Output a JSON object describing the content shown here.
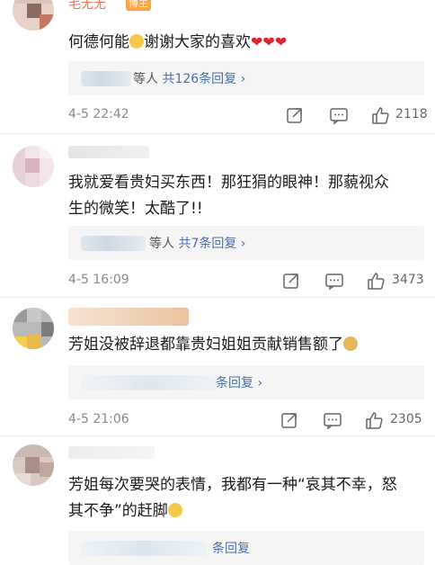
{
  "comments": [
    {
      "username": "毛无无",
      "badge": "博主",
      "text": "何德何能",
      "text_after_emoji": "谢谢大家的喜欢",
      "hearts": "❤❤❤",
      "reply_who": "等人",
      "reply_count": "共126条回复 ›",
      "date": "4-5 22:42",
      "likes": "2118"
    },
    {
      "text_line1": "我就爱看贵妇买东西！那狂狷的眼神！那藐视众",
      "text_line2": "生的微笑！太酷了!!",
      "reply_who": "等人",
      "reply_count": "共7条回复 ›",
      "date": "4-5 16:09",
      "likes": "3473"
    },
    {
      "text": "芳姐没被辞退都靠贵妇姐姐贡献销售额了",
      "reply_tail": "条回复 ›",
      "date": "4-5 21:06",
      "likes": "2305"
    },
    {
      "text_line1": "芳姐每次要哭的表情，我都有一种“哀其不幸，怒",
      "text_line2": "其不争”的赶脚",
      "reply_tail": "条回复"
    }
  ],
  "icons": {
    "repost": "repost-icon",
    "comment": "comment-icon",
    "like": "thumbs-up-icon"
  },
  "colors": {
    "link": "#4a6fa5",
    "username": "#eb7350",
    "heart": "#e0242d",
    "meta": "#888888"
  }
}
